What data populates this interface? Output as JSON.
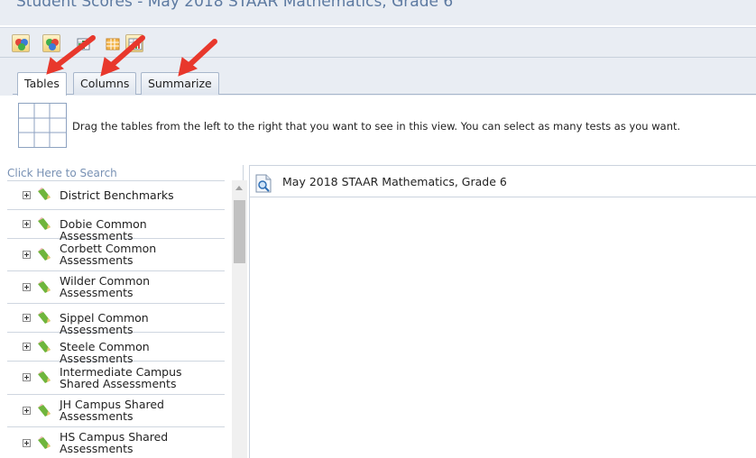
{
  "window": {
    "title": "Student Scores - May 2018 STAAR Mathematics, Grade 6"
  },
  "toolbar": {
    "buttons": [
      {
        "icon": "colored-circles-icon"
      },
      {
        "icon": "colored-circles-alt-icon"
      },
      {
        "icon": "table-chart-icon"
      },
      {
        "icon": "grid-orange-icon"
      },
      {
        "icon": "grid-chart-icon"
      }
    ]
  },
  "tabs": [
    {
      "label": "Tables",
      "active": true
    },
    {
      "label": "Columns",
      "active": false
    },
    {
      "label": "Summarize",
      "active": false
    }
  ],
  "instruction": {
    "text": "Drag the tables from the left to the right that you want to see in this view. You can select as many tests as you want."
  },
  "search": {
    "placeholder": "Click Here to Search"
  },
  "tree": {
    "items": [
      {
        "label": "District Benchmarks"
      },
      {
        "label": "Dobie Common Assessments"
      },
      {
        "label": "Corbett Common Assessments"
      },
      {
        "label": "Wilder Common Assessments"
      },
      {
        "label": "Sippel Common Assessments"
      },
      {
        "label": "Steele Common Assessments"
      },
      {
        "label": "Intermediate Campus Shared Assessments"
      },
      {
        "label": "JH Campus Shared Assessments"
      },
      {
        "label": "HS Campus Shared Assessments"
      }
    ]
  },
  "selected": {
    "items": [
      {
        "label": "May 2018 STAAR Mathematics, Grade 6"
      }
    ]
  },
  "colors": {
    "header_bg": "#e9edf3",
    "title_text": "#5d7aa1",
    "annotation_arrow": "#e8382c"
  }
}
